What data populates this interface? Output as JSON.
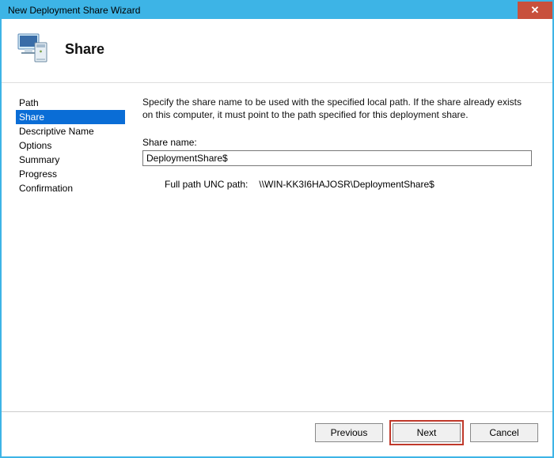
{
  "window": {
    "title": "New Deployment Share Wizard",
    "close_glyph": "✕"
  },
  "header": {
    "title": "Share"
  },
  "sidebar": {
    "items": [
      {
        "label": "Path",
        "selected": false
      },
      {
        "label": "Share",
        "selected": true
      },
      {
        "label": "Descriptive Name",
        "selected": false
      },
      {
        "label": "Options",
        "selected": false
      },
      {
        "label": "Summary",
        "selected": false
      },
      {
        "label": "Progress",
        "selected": false
      },
      {
        "label": "Confirmation",
        "selected": false
      }
    ]
  },
  "main": {
    "instruction": "Specify the share name to be used with the specified local path.  If the share already exists on this computer, it must point to the path specified for this deployment share.",
    "share_name_label": "Share name:",
    "share_name_value": "DeploymentShare$",
    "unc_label": "Full path UNC path:",
    "unc_value": "\\\\WIN-KK3I6HAJOSR\\DeploymentShare$"
  },
  "footer": {
    "previous": "Previous",
    "next": "Next",
    "cancel": "Cancel"
  }
}
